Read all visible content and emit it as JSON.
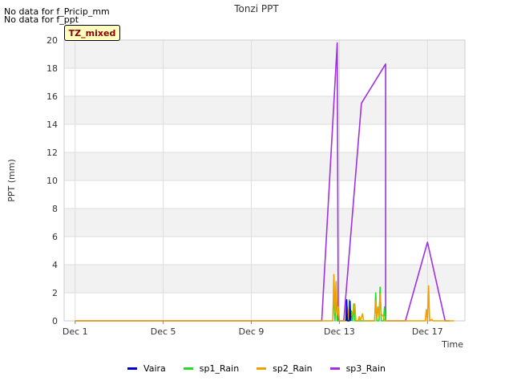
{
  "messages": [
    "No data for f_Pricip_mm",
    "No data for f_ppt"
  ],
  "badge": "TZ_mixed",
  "chart_data": {
    "type": "line",
    "title": "Tonzi PPT",
    "xlabel": "Time",
    "ylabel": "PPT (mm)",
    "xlim": [
      0.5,
      18.7
    ],
    "ylim": [
      0,
      20
    ],
    "x_ticks": [
      1,
      5,
      9,
      13,
      17
    ],
    "x_tick_labels": [
      "Dec 1",
      "Dec 5",
      "Dec 9",
      "Dec 13",
      "Dec 17"
    ],
    "y_ticks": [
      0,
      2,
      4,
      6,
      8,
      10,
      12,
      14,
      16,
      18,
      20
    ],
    "grid": true,
    "legend_position": "bottom",
    "series": [
      {
        "name": "Vaira",
        "color": "#0000cd",
        "points": [
          [
            13.3,
            0
          ],
          [
            13.33,
            1.5
          ],
          [
            13.36,
            0
          ],
          [
            13.45,
            0
          ],
          [
            13.48,
            1.4
          ],
          [
            13.52,
            0
          ]
        ]
      },
      {
        "name": "sp1_Rain",
        "color": "#22dd22",
        "points": [
          [
            12.7,
            0
          ],
          [
            12.75,
            2.2
          ],
          [
            12.8,
            0
          ],
          [
            12.85,
            2.0
          ],
          [
            12.9,
            0
          ],
          [
            13.3,
            0
          ],
          [
            13.35,
            1.0
          ],
          [
            13.4,
            0
          ],
          [
            13.45,
            1.5
          ],
          [
            13.5,
            0
          ],
          [
            13.55,
            0.7
          ],
          [
            13.6,
            0
          ],
          [
            13.65,
            1.2
          ],
          [
            13.7,
            0
          ],
          [
            14.6,
            0
          ],
          [
            14.65,
            2.0
          ],
          [
            14.7,
            0
          ],
          [
            14.8,
            0
          ],
          [
            14.85,
            2.4
          ],
          [
            14.9,
            0
          ],
          [
            15.0,
            0
          ],
          [
            15.05,
            1.0
          ],
          [
            15.1,
            0
          ]
        ]
      },
      {
        "name": "sp2_Rain",
        "color": "#f0a000",
        "points": [
          [
            1.0,
            0
          ],
          [
            12.7,
            0
          ],
          [
            12.75,
            3.3
          ],
          [
            12.8,
            0.6
          ],
          [
            12.85,
            2.8
          ],
          [
            12.9,
            0.4
          ],
          [
            12.95,
            1.0
          ],
          [
            13.0,
            0
          ],
          [
            13.3,
            0
          ],
          [
            13.35,
            1.0
          ],
          [
            13.4,
            0.2
          ],
          [
            13.45,
            1.2
          ],
          [
            13.5,
            0.3
          ],
          [
            13.6,
            0.5
          ],
          [
            13.7,
            1.2
          ],
          [
            13.75,
            0
          ],
          [
            13.85,
            0
          ],
          [
            13.9,
            0.3
          ],
          [
            13.95,
            0
          ],
          [
            14.05,
            0.5
          ],
          [
            14.1,
            0
          ],
          [
            14.6,
            0
          ],
          [
            14.65,
            1.4
          ],
          [
            14.7,
            0.2
          ],
          [
            14.75,
            1.0
          ],
          [
            14.8,
            0.3
          ],
          [
            14.85,
            1.9
          ],
          [
            14.9,
            0.5
          ],
          [
            15.0,
            0.3
          ],
          [
            15.05,
            0
          ],
          [
            16.9,
            0
          ],
          [
            16.95,
            0.8
          ],
          [
            17.0,
            0
          ],
          [
            17.05,
            2.5
          ],
          [
            17.1,
            0
          ],
          [
            17.2,
            0.1
          ],
          [
            17.25,
            0
          ],
          [
            18.2,
            0
          ]
        ]
      },
      {
        "name": "sp3_Rain",
        "color": "#a030e0",
        "points": [
          [
            1.0,
            0
          ],
          [
            12.2,
            0
          ],
          [
            12.9,
            19.8
          ],
          [
            12.95,
            0
          ],
          [
            13.2,
            0
          ],
          [
            14.0,
            15.5
          ],
          [
            15.1,
            18.3
          ],
          [
            15.1,
            0
          ],
          [
            16.0,
            0
          ],
          [
            17.0,
            5.6
          ],
          [
            17.8,
            0
          ],
          [
            18.0,
            0
          ]
        ]
      }
    ]
  }
}
